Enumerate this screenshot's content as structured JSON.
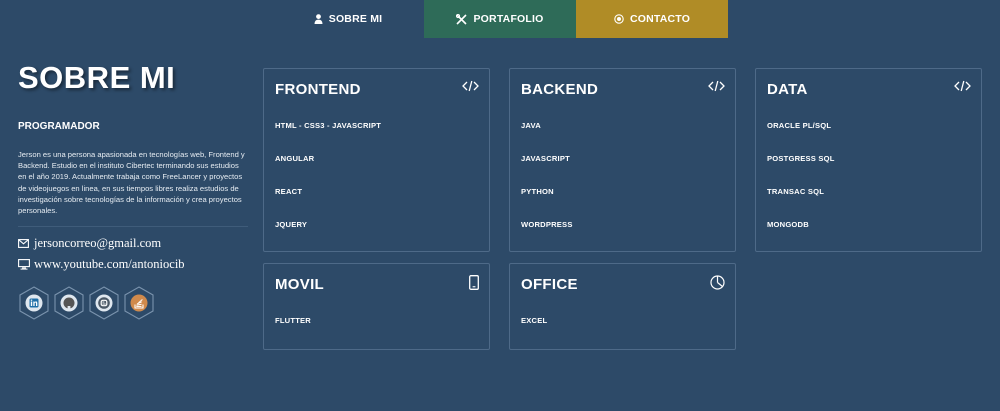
{
  "nav": {
    "tabs": [
      {
        "label": "SOBRE MI",
        "icon": "user-icon"
      },
      {
        "label": "PORTAFOLIO",
        "icon": "tools-icon"
      },
      {
        "label": "CONTACTO",
        "icon": "dot-circle-icon"
      }
    ]
  },
  "profile": {
    "title": "SOBRE MI",
    "role": "PROGRAMADOR",
    "bio": "Jerson es una persona apasionada en tecnologías web, Frontend y Backend. Estudio en el instituto Cibertec terminando sus estudios en el año 2019. Actualmente trabaja como FreeLancer y proyectos de videojuegos en linea, en sus tiempos libres realiza estudios de investigación sobre tecnologías de la información y crea proyectos personales.",
    "email": "jersoncorreo@gmail.com",
    "website": "www.youtube.com/antoniocib",
    "socials": [
      "linkedin-icon",
      "github-icon",
      "blogger-icon",
      "stackoverflow-icon"
    ]
  },
  "cards": [
    {
      "title": "FRONTEND",
      "icon": "code-icon",
      "items": [
        "HTML - CSS3 - JAVASCRIPT",
        "ANGULAR",
        "REACT",
        "JQUERY"
      ]
    },
    {
      "title": "BACKEND",
      "icon": "code-icon",
      "items": [
        "JAVA",
        "JAVASCRIPT",
        "PYTHON",
        "WORDPRESS"
      ]
    },
    {
      "title": "DATA",
      "icon": "code-icon",
      "items": [
        "ORACLE PL/SQL",
        "POSTGRESS SQL",
        "TRANSAC SQL",
        "MONGODB"
      ]
    },
    {
      "title": "MOVIL",
      "icon": "mobile-icon",
      "items": [
        "FLUTTER"
      ]
    },
    {
      "title": "OFFICE",
      "icon": "pie-chart-icon",
      "items": [
        "EXCEL"
      ]
    }
  ],
  "colors": {
    "background": "#2d4a68",
    "portfolio_tab": "#2e6b58",
    "contact_tab": "#b08c26",
    "card_border": "#4e6a88"
  }
}
